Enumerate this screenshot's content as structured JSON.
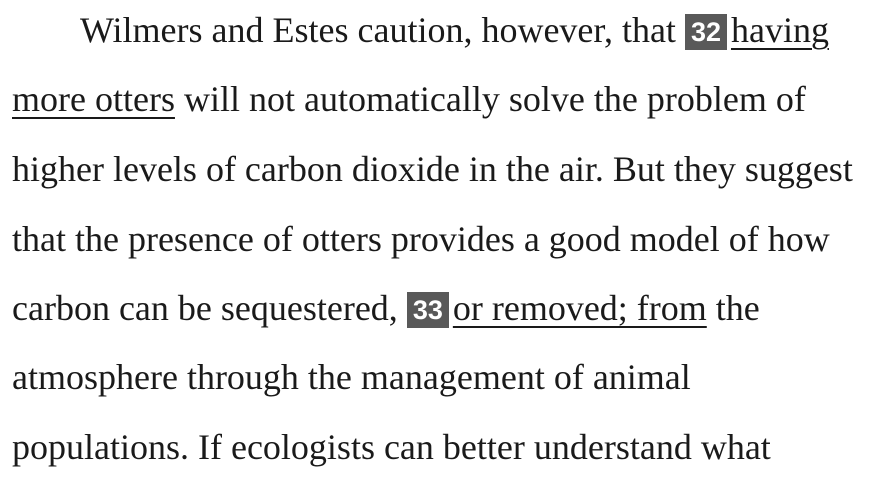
{
  "passage": {
    "line1": {
      "text": "Wilmers and Estes caution, however, that",
      "question_number": "32",
      "underlined": "having"
    },
    "line2": {
      "underlined": "more otters",
      "text": "will not automatically solve the problem of"
    },
    "line3": {
      "text": "higher levels of carbon dioxide in the air. But they suggest"
    },
    "line4": {
      "text": "that the presence of otters provides a good model of how"
    },
    "line5": {
      "text": "carbon can be sequestered,",
      "question_number": "33",
      "underlined": "or removed; from",
      "text_after": "the"
    },
    "line6": {
      "text": "atmosphere through the management of animal"
    },
    "line7": {
      "text": "populations. If ecologists can better understand what"
    }
  },
  "colors": {
    "text": "#1a1a1a",
    "badge_background": "#595959",
    "badge_text": "#ffffff"
  }
}
